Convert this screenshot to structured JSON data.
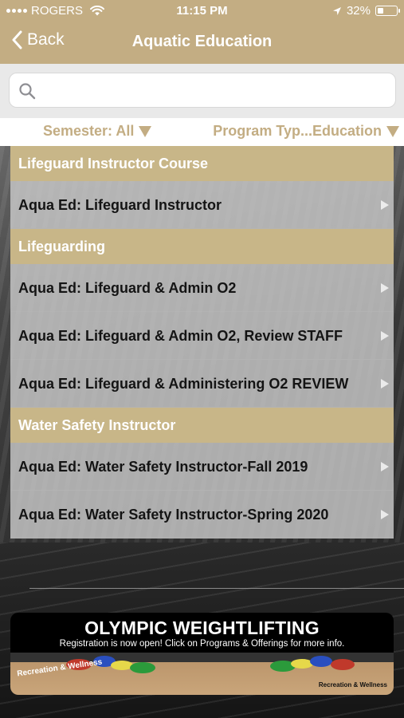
{
  "status_bar": {
    "carrier": "ROGERS",
    "time": "11:15 PM",
    "battery": "32%",
    "battery_level": 0.32
  },
  "nav": {
    "back_label": "Back",
    "title": "Aquatic Education"
  },
  "search": {
    "value": "",
    "placeholder": ""
  },
  "filters": {
    "semester": "Semester: All",
    "program_type": "Program Typ...Education"
  },
  "sections": [
    {
      "header": "Lifeguard Instructor Course",
      "items": [
        "Aqua Ed: Lifeguard Instructor"
      ]
    },
    {
      "header": "Lifeguarding",
      "items": [
        "Aqua Ed: Lifeguard & Admin O2",
        "Aqua Ed: Lifeguard & Admin O2, Review STAFF",
        "Aqua Ed: Lifeguard & Administering O2 REVIEW"
      ]
    },
    {
      "header": "Water Safety Instructor",
      "items": [
        "Aqua Ed: Water Safety Instructor-Fall 2019",
        "Aqua Ed: Water Safety Instructor-Spring 2020"
      ]
    }
  ],
  "banner": {
    "title": "OLYMPIC WEIGHTLIFTING",
    "subtitle": "Registration is now open! Click on Programs & Offerings for more info.",
    "logo_left": "Recreation & Wellness",
    "logo_right": "Recreation & Wellness"
  },
  "colors": {
    "brand_gold": "#c3ad83",
    "section_gold": "#c8b688"
  }
}
